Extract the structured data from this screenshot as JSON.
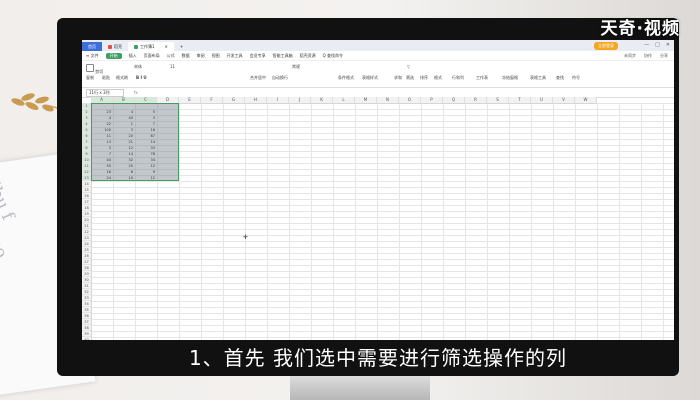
{
  "overlay": {
    "watermark": "天奇·视频",
    "subtitle": "1、首先 我们选中需要进行筛选操作的列"
  },
  "window": {
    "tabs": [
      {
        "label": "首页",
        "type": "home"
      },
      {
        "label": "稻壳",
        "type": "docer"
      },
      {
        "label": "工作簿1",
        "type": "active"
      }
    ],
    "new_tab": "+",
    "login_label": "立即登录",
    "controls": [
      "—",
      "□",
      "✕"
    ]
  },
  "menu": {
    "file": "≡ 文件",
    "start": "开始",
    "items": [
      "插入",
      "页面布局",
      "公式",
      "数据",
      "审阅",
      "视图",
      "开发工具",
      "会员专享",
      "智能工具箱",
      "稻壳资源"
    ],
    "search": "Q 查找命令",
    "right_items": [
      "未同步",
      "协作",
      "分享"
    ]
  },
  "ribbon": {
    "items": [
      "剪切",
      "复制",
      "粘贴",
      "格式刷",
      "宋体",
      "11",
      "合并居中",
      "自动换行",
      "常规",
      "条件格式",
      "表格样式",
      "求和",
      "筛选",
      "排序",
      "格式",
      "行和列",
      "工作表",
      "冻结窗格",
      "表格工具",
      "查找",
      "符号"
    ]
  },
  "formula_bar": {
    "name_box": "11行 x 3列",
    "fx": "fx"
  },
  "sheet": {
    "columns": [
      "A",
      "B",
      "C",
      "D",
      "E",
      "F",
      "G",
      "H",
      "I",
      "J",
      "K",
      "L",
      "M",
      "N",
      "O",
      "P",
      "Q",
      "R",
      "S",
      "T",
      "U",
      "V",
      "W"
    ],
    "selected_columns": [
      "A",
      "B",
      "C"
    ],
    "rows": [
      "1",
      "2",
      "3",
      "4",
      "5",
      "6",
      "7",
      "8",
      "9",
      "10",
      "11",
      "12",
      "13",
      "14",
      "15",
      "16",
      "17",
      "18",
      "19",
      "20",
      "21",
      "22",
      "23",
      "24",
      "25",
      "26",
      "27",
      "28",
      "29",
      "30",
      "31",
      "32",
      "33",
      "34",
      "35",
      "36",
      "37",
      "38",
      "39",
      "40"
    ],
    "selected_rows": 13,
    "col_a": [
      "",
      "23",
      "4",
      "22",
      "100",
      "11",
      "13",
      "3",
      "7",
      "44",
      "55",
      "16",
      "24"
    ],
    "col_b": [
      "",
      "4",
      "40",
      "1",
      "3",
      "20",
      "21",
      "12",
      "14",
      "32",
      "20",
      "6",
      "10"
    ],
    "col_c": [
      "",
      "5",
      "3",
      "7",
      "16",
      "67",
      "14",
      "33",
      "78",
      "34",
      "12",
      "9",
      "12"
    ]
  }
}
